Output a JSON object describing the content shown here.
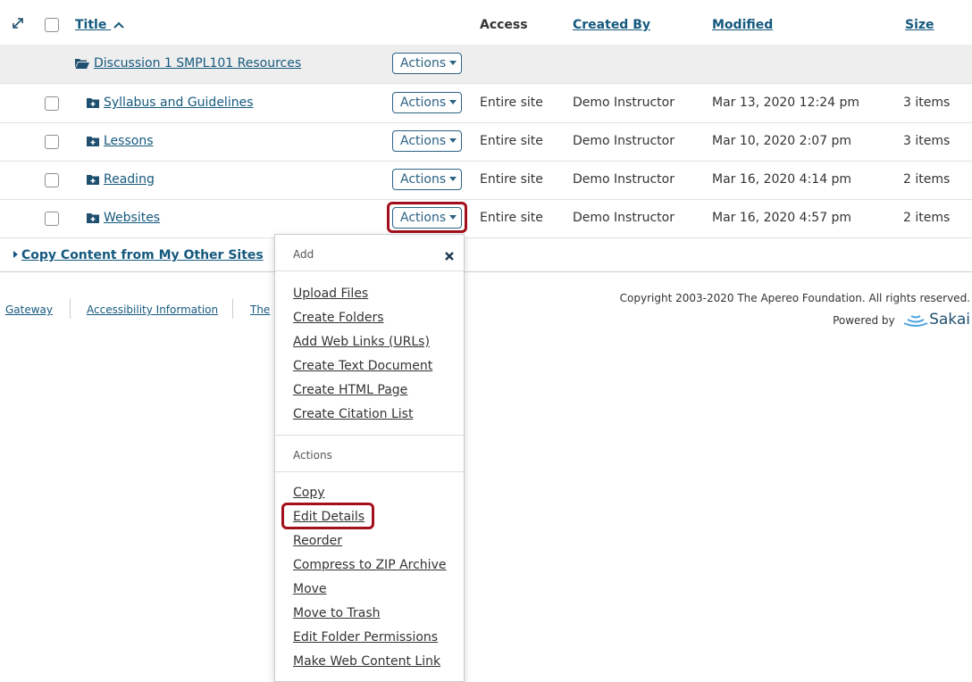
{
  "table": {
    "headers": {
      "title": "Title",
      "access": "Access",
      "created_by": "Created By",
      "modified": "Modified",
      "size": "Size"
    },
    "parent_row": {
      "title": "Discussion 1 SMPL101 Resources",
      "actions": "Actions"
    },
    "rows": [
      {
        "title": "Syllabus and Guidelines",
        "actions": "Actions",
        "access": "Entire site",
        "created_by": "Demo Instructor",
        "modified": "Mar 13, 2020 12:24 pm",
        "size": "3 items"
      },
      {
        "title": "Lessons",
        "actions": "Actions",
        "access": "Entire site",
        "created_by": "Demo Instructor",
        "modified": "Mar 10, 2020 2:07 pm",
        "size": "3 items"
      },
      {
        "title": "Reading",
        "actions": "Actions",
        "access": "Entire site",
        "created_by": "Demo Instructor",
        "modified": "Mar 16, 2020 4:14 pm",
        "size": "2 items"
      },
      {
        "title": "Websites",
        "actions": "Actions",
        "access": "Entire site",
        "created_by": "Demo Instructor",
        "modified": "Mar 16, 2020 4:57 pm",
        "size": "2 items"
      }
    ]
  },
  "copy_content": "Copy Content from My Other Sites",
  "menu": {
    "add_header": "Add",
    "add_items": [
      "Upload Files",
      "Create Folders",
      "Add Web Links (URLs)",
      "Create Text Document",
      "Create HTML Page",
      "Create Citation List"
    ],
    "actions_header": "Actions",
    "action_items": [
      "Copy",
      "Edit Details",
      "Reorder",
      "Compress to ZIP Archive",
      "Move",
      "Move to Trash",
      "Edit Folder Permissions",
      "Make Web Content Link"
    ]
  },
  "footer": {
    "links": [
      "Gateway",
      "Accessibility Information",
      "The"
    ],
    "copyright": "Copyright 2003-2020 The Apereo Foundation. All rights reserved.",
    "powered_by": "Powered by",
    "brand": "Sakai"
  },
  "colors": {
    "link": "#15597e",
    "highlight": "#a30f1d",
    "parent_row_bg": "#eeeeee"
  }
}
